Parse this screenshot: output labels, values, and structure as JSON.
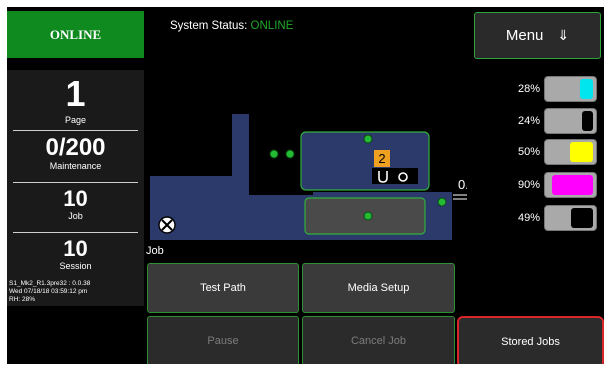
{
  "left_panel": {
    "connection_badge": "ONLINE",
    "stats": [
      {
        "value": "1",
        "label": "Page"
      },
      {
        "value": "0/200",
        "label": "Maintenance"
      },
      {
        "value": "10",
        "label": "Job"
      },
      {
        "value": "10",
        "label": "Session"
      }
    ],
    "info_lines": [
      "S1_Mk2_R1.3pre32 : 0.0.38",
      "Wed 07/18/18 03:59:12 pm",
      "RH: 28%"
    ]
  },
  "status_bar": {
    "label": "System Status:",
    "value": "ONLINE"
  },
  "menu": {
    "label": "Menu",
    "arrow": "⇓"
  },
  "printer_diagram": {
    "sheet_count": "2",
    "offset_value": "0.6",
    "icons": [
      "cancel-circle-icon",
      "sensor-icon",
      "paper-path-icon"
    ]
  },
  "job_section": {
    "label": "Job"
  },
  "ink_levels": [
    {
      "percent": "28%",
      "color": "#00e5ee",
      "level": 0.28
    },
    {
      "percent": "24%",
      "color": "#000000",
      "level": 0.24
    },
    {
      "percent": "50%",
      "color": "#ffff00",
      "level": 0.5
    },
    {
      "percent": "90%",
      "color": "#ff00ff",
      "level": 0.9
    },
    {
      "percent": "49%",
      "color": "#000000",
      "level": 0.49
    }
  ],
  "buttons": {
    "test_path": "Test Path",
    "media_setup": "Media Setup",
    "pause": "Pause",
    "cancel_job": "Cancel Job",
    "stored_jobs": "Stored Jobs"
  },
  "colors": {
    "online_green": "#0f8a1f",
    "button_border": "#2e8f34",
    "highlight_red": "#d8262b",
    "diagram_blue": "#2b3a6b"
  }
}
